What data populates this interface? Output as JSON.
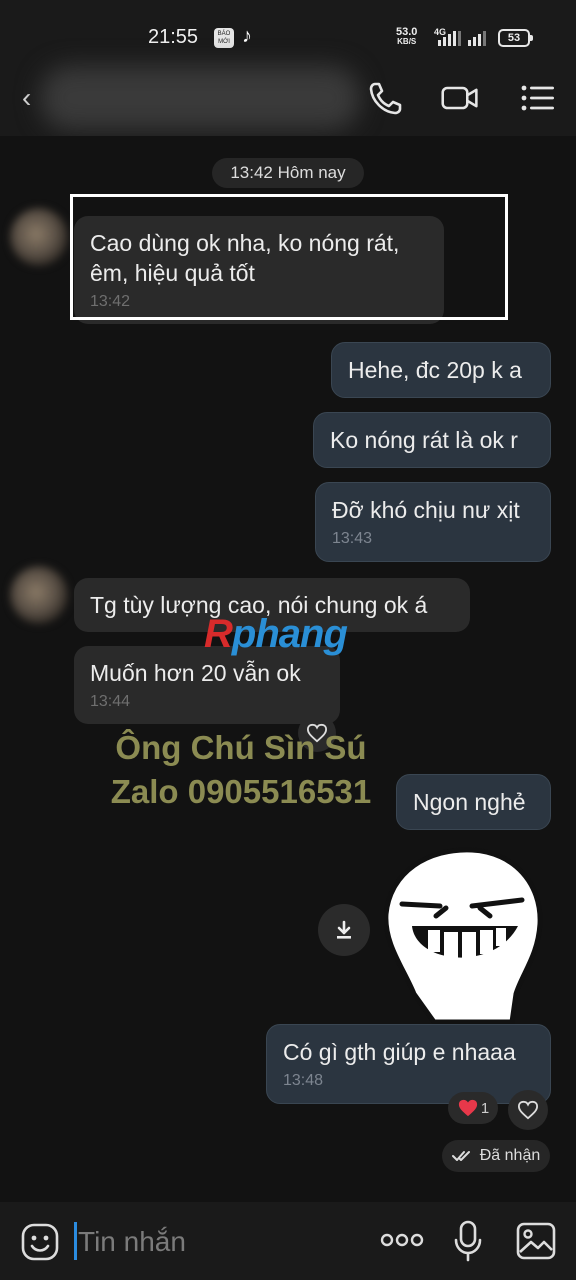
{
  "status_bar": {
    "time": "21:55",
    "app_badge": "BÁO MỚI",
    "speed_value": "53.0",
    "speed_unit": "KB/S",
    "network": "4G",
    "battery": "53"
  },
  "header": {
    "contact_name": ""
  },
  "chat": {
    "date_separator": "13:42 Hôm nay",
    "messages": [
      {
        "text": "Cao dùng ok nha, ko nóng rát, êm, hiệu quả tốt",
        "time": "13:42"
      },
      {
        "text": "Hehe, đc 20p k a"
      },
      {
        "text": "Ko nóng rát là ok r"
      },
      {
        "text": "Đỡ khó chịu nư xịt",
        "time": "13:43"
      },
      {
        "text": "Tg tùy lượng cao, nói chung ok á"
      },
      {
        "text": "Muốn hơn 20 vẫn ok",
        "time": "13:44"
      },
      {
        "text": "Ngon nghẻ"
      },
      {
        "text": "Có gì gth giúp e nhaaa",
        "time": "13:48"
      }
    ],
    "watermark_logo_a": "R",
    "watermark_logo_b": "phang",
    "watermark_line1": "Ông Chú Sìn Sú",
    "watermark_line2": "Zalo 0905516531",
    "reaction_count": "1",
    "received_label": "Đã nhận"
  },
  "input": {
    "placeholder": "Tin nhắn"
  },
  "colors": {
    "background": "#121212",
    "incoming_bubble": "#2a2a2a",
    "outgoing_bubble": "#2b3540",
    "accent": "#2b8ce0"
  }
}
